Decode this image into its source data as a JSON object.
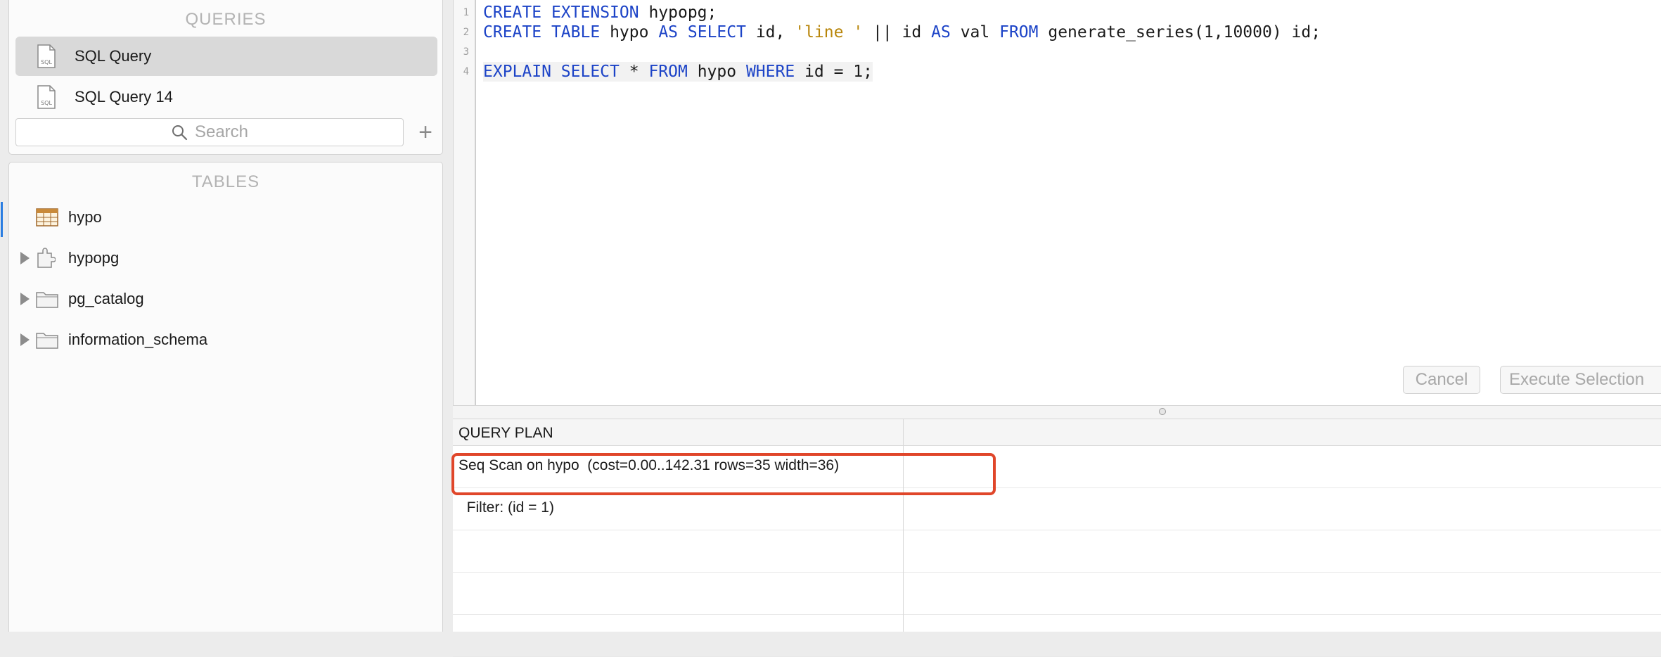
{
  "sidebar": {
    "queries_title": "QUERIES",
    "queries": [
      {
        "label": "SQL Query",
        "selected": true
      },
      {
        "label": "SQL Query 14",
        "selected": false
      }
    ],
    "search_placeholder": "Search",
    "add_label": "+",
    "tables_title": "TABLES",
    "tables": [
      {
        "label": "hypo",
        "icon": "table-icon",
        "expandable": false
      },
      {
        "label": "hypopg",
        "icon": "extension-icon",
        "expandable": true
      },
      {
        "label": "pg_catalog",
        "icon": "folder-icon",
        "expandable": true
      },
      {
        "label": "information_schema",
        "icon": "folder-icon",
        "expandable": true
      }
    ]
  },
  "editor": {
    "line_numbers": [
      "1",
      "2",
      "3",
      "4"
    ],
    "lines": [
      "CREATE EXTENSION hypopg;",
      "CREATE TABLE hypo AS SELECT id, 'line ' || id AS val FROM generate_series(1,10000) id;",
      "",
      "EXPLAIN SELECT * FROM hypo WHERE id = 1;"
    ],
    "cancel_label": "Cancel",
    "execute_label": "Execute Selection"
  },
  "results": {
    "column_header": "QUERY PLAN",
    "rows": [
      "Seq Scan on hypo  (cost=0.00..142.31 rows=35 width=36)",
      "  Filter: (id = 1)",
      "",
      "",
      ""
    ]
  },
  "colors": {
    "keyword": "#1c43c7",
    "string": "#b8860b",
    "highlight": "#e0462a"
  }
}
